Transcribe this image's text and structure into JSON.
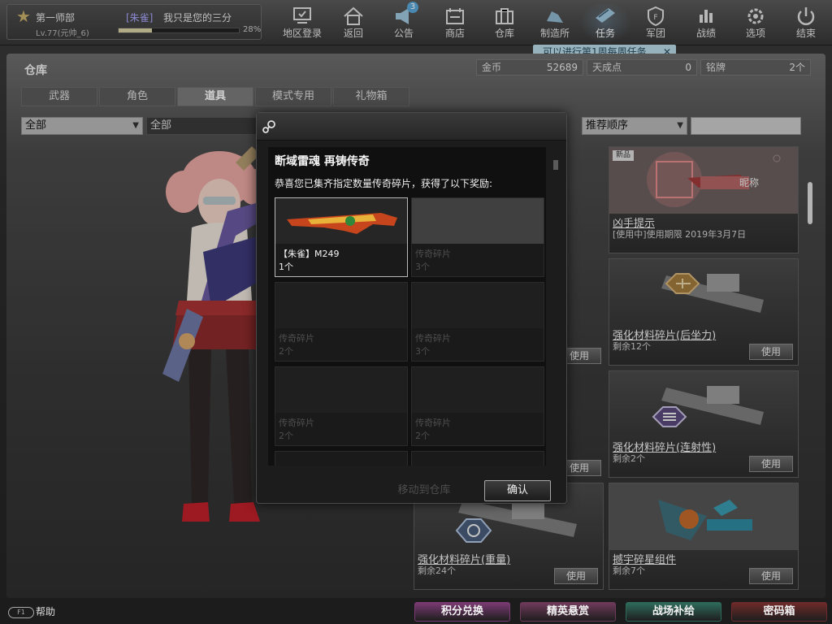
{
  "player": {
    "name": "第一师部",
    "title": "[朱雀]",
    "motto": "我只是您的三分",
    "level": "Lv.77(元帅_6)",
    "exp_pct_label": "28%",
    "exp_fraction": 0.28
  },
  "nav": [
    {
      "label": "地区登录",
      "icon": "region-login-icon"
    },
    {
      "label": "返回",
      "icon": "home-icon"
    },
    {
      "label": "公告",
      "icon": "megaphone-icon",
      "badge": "3"
    },
    {
      "label": "商店",
      "icon": "shop-icon"
    },
    {
      "label": "仓库",
      "icon": "warehouse-icon"
    },
    {
      "label": "制造所",
      "icon": "factory-icon"
    },
    {
      "label": "任务",
      "icon": "task-icon"
    },
    {
      "label": "军团",
      "icon": "legion-icon"
    },
    {
      "label": "战绩",
      "icon": "stats-icon"
    },
    {
      "label": "选项",
      "icon": "gear-icon"
    },
    {
      "label": "结束",
      "icon": "power-icon"
    }
  ],
  "task_tip": "可以进行第1周每周任务",
  "page_title": "仓库",
  "currency": [
    {
      "label": "金币",
      "value": "52689"
    },
    {
      "label": "天成点",
      "value": "0"
    },
    {
      "label": "铭牌",
      "value": "2个"
    }
  ],
  "tabs": [
    "武器",
    "角色",
    "道具",
    "模式专用",
    "礼物箱"
  ],
  "active_tab": "道具",
  "filters": {
    "category": "全部",
    "subcategory": "全部",
    "sort": "推荐顺序",
    "search_placeholder": ""
  },
  "cards": [
    {
      "name": "凶手提示",
      "sub": "[使用中]使用期限 2019年3月7日",
      "badge": "新品",
      "overlay": "昵称",
      "use": ""
    },
    {
      "name": "强化材料碎片(后坐力)",
      "sub": "剩余12个",
      "use": "使用"
    },
    {
      "name": "强化材料碎片(连射性)",
      "sub": "剩余2个",
      "use": "使用"
    },
    {
      "name": "强化材料碎片(重量)",
      "sub": "剩余24个",
      "use": "使用"
    },
    {
      "name": "撼宇碎星组件",
      "sub": "剩余7个",
      "use": "使用"
    }
  ],
  "hidden_use_labels": [
    "使用",
    "使用"
  ],
  "modal": {
    "title": "断域雷魂 再铸传奇",
    "message": "恭喜您已集齐指定数量传奇碎片，获得了以下奖励:",
    "slots": [
      {
        "name": "【朱雀】M249",
        "count": "1个",
        "dim": false
      },
      {
        "name": "传奇碎片",
        "count": "3个",
        "dim": true
      },
      {
        "name": "传奇碎片",
        "count": "2个",
        "dim": true
      },
      {
        "name": "传奇碎片",
        "count": "3个",
        "dim": true
      },
      {
        "name": "传奇碎片",
        "count": "2个",
        "dim": true
      },
      {
        "name": "传奇碎片",
        "count": "2个",
        "dim": true
      }
    ],
    "move_label": "移动到仓库",
    "confirm_label": "确认"
  },
  "help_label": "帮助",
  "help_key": "F1",
  "bottom_buttons": [
    {
      "label": "积分兑换",
      "color": "#7a3a73"
    },
    {
      "label": "精英悬赏",
      "color": "#6e3a5a"
    },
    {
      "label": "战场补给",
      "color": "#2e6a5a"
    },
    {
      "label": "密码箱",
      "color": "#6e2a2a"
    }
  ]
}
